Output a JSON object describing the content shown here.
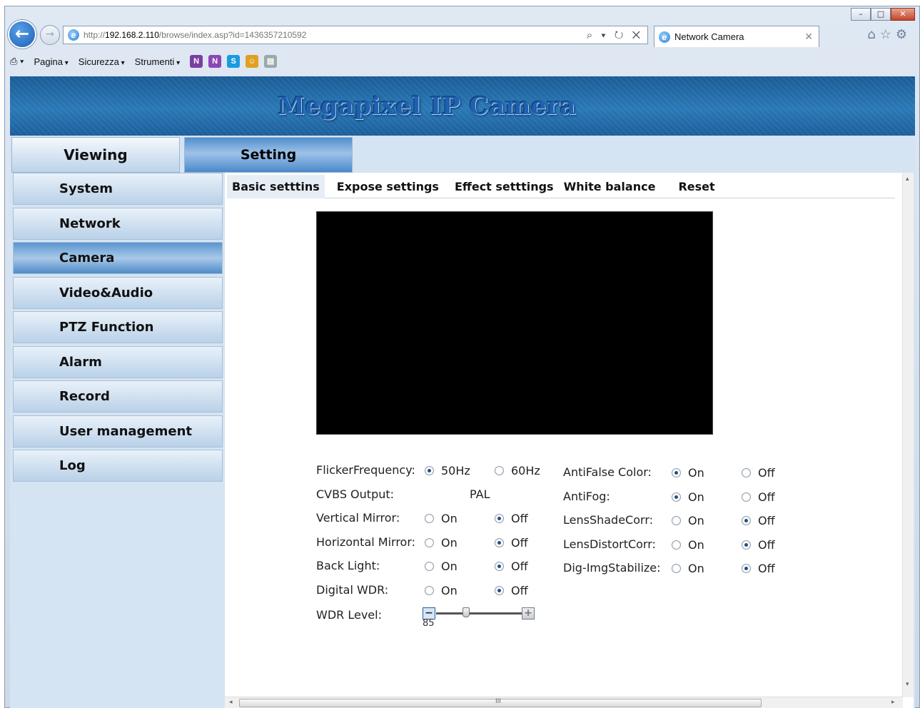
{
  "browser": {
    "url_prefix": "http://",
    "url_host": "192.168.2.110",
    "url_path": "/browse/index.asp?id=1436357210592",
    "tab_title": "Network Camera",
    "back_glyph": "←",
    "forward_glyph": "→",
    "addr_tools": "⌕ ▾ ↻ ✕",
    "tab_close": "✕",
    "right_icons": "⌂☆⚙",
    "win_controls": [
      "–",
      "□",
      "✕"
    ]
  },
  "commandbar": {
    "items": [
      "Pagina",
      "Sicurezza",
      "Strumenti"
    ],
    "print_glyph": "⎙ ▾",
    "extra_icons": [
      {
        "name": "onenote-icon",
        "glyph": "N",
        "color": "#7a3fa0"
      },
      {
        "name": "onenote-send-icon",
        "glyph": "N",
        "color": "#8a48b5"
      },
      {
        "name": "skype-icon",
        "glyph": "S",
        "color": "#1a9be0"
      },
      {
        "name": "messenger-icon",
        "glyph": "☺",
        "color": "#e0a020"
      },
      {
        "name": "page-view-icon",
        "glyph": "▤",
        "color": "#9aa"
      }
    ]
  },
  "banner": {
    "title": "Megapixel IP Camera"
  },
  "top_tabs": [
    {
      "label": "Viewing",
      "active": false
    },
    {
      "label": "Setting",
      "active": true
    }
  ],
  "sidebar": {
    "items": [
      {
        "label": "System",
        "active": false
      },
      {
        "label": "Network",
        "active": false
      },
      {
        "label": "Camera",
        "active": true
      },
      {
        "label": "Video&Audio",
        "active": false
      },
      {
        "label": "PTZ Function",
        "active": false
      },
      {
        "label": "Alarm",
        "active": false
      },
      {
        "label": "Record",
        "active": false
      },
      {
        "label": "User management",
        "active": false
      },
      {
        "label": "Log",
        "active": false
      }
    ]
  },
  "subtabs": [
    "Basic setttins",
    "Expose settings",
    "Effect setttings",
    "White balance",
    "Reset"
  ],
  "settings_left": [
    {
      "label": "FlickerFrequency:",
      "opt1": "50Hz",
      "opt2": "60Hz",
      "selected": 1
    },
    {
      "label": "CVBS Output:",
      "value": "PAL"
    },
    {
      "label": "Vertical Mirror:",
      "opt1": "On",
      "opt2": "Off",
      "selected": 2
    },
    {
      "label": "Horizontal Mirror:",
      "opt1": "On",
      "opt2": "Off",
      "selected": 2
    },
    {
      "label": "Back Light:",
      "opt1": "On",
      "opt2": "Off",
      "selected": 2
    },
    {
      "label": "Digital WDR:",
      "opt1": "On",
      "opt2": "Off",
      "selected": 2
    }
  ],
  "settings_right": [
    {
      "label": "AntiFalse Color:",
      "opt1": "On",
      "opt2": "Off",
      "selected": 1
    },
    {
      "label": "AntiFog:",
      "opt1": "On",
      "opt2": "Off",
      "selected": 1
    },
    {
      "label": "LensShadeCorr:",
      "opt1": "On",
      "opt2": "Off",
      "selected": 2
    },
    {
      "label": "LensDistortCorr:",
      "opt1": "On",
      "opt2": "Off",
      "selected": 2
    },
    {
      "label": "Dig-ImgStabilize:",
      "opt1": "On",
      "opt2": "Off",
      "selected": 2
    }
  ],
  "wdr": {
    "label": "WDR Level:",
    "value": "85",
    "level_fraction": 0.35,
    "minus_glyph": "−",
    "plus_glyph": "+"
  },
  "scroll": {
    "grip": "III",
    "left": "◂",
    "right": "▸",
    "up": "▴",
    "down": "▾"
  }
}
